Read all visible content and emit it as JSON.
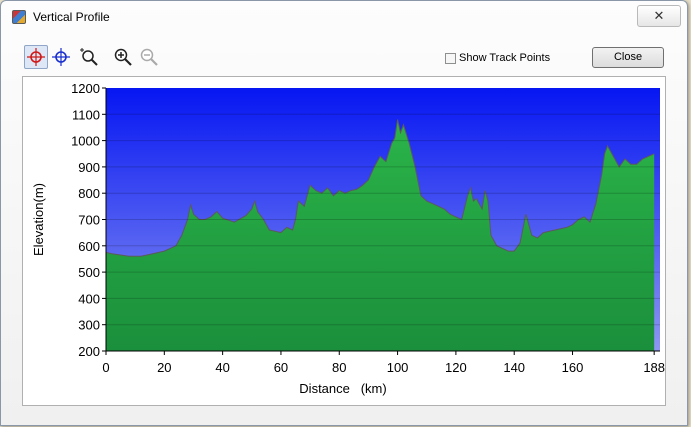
{
  "window": {
    "title": "Vertical Profile",
    "close_glyph": "✕"
  },
  "toolbar": {
    "tools": [
      {
        "icon": "crosshair-red-icon",
        "selected": true
      },
      {
        "icon": "crosshair-blue-icon",
        "selected": false
      },
      {
        "icon": "zoom-region-icon",
        "selected": false
      },
      {
        "icon": "zoom-in-icon",
        "selected": false
      },
      {
        "icon": "zoom-out-icon",
        "selected": false,
        "disabled": true
      }
    ],
    "show_track_points_label": "Show Track Points",
    "show_track_points_checked": false,
    "close_label": "Close"
  },
  "chart_data": {
    "type": "area",
    "xlabel": "Distance   (km)",
    "ylabel": "Elevation(m)",
    "x_ticks": [
      "0",
      "20",
      "40",
      "60",
      "80",
      "100",
      "120",
      "140",
      "160",
      "188"
    ],
    "x_tick_values": [
      0,
      20,
      40,
      60,
      80,
      100,
      120,
      140,
      160,
      188
    ],
    "y_ticks": [
      "200",
      "300",
      "400",
      "500",
      "600",
      "700",
      "800",
      "900",
      "1000",
      "1100",
      "1200"
    ],
    "xlim": [
      0,
      190
    ],
    "ylim": [
      200,
      1200
    ],
    "grid": "horizontal",
    "colors": {
      "sky_top": "#0616f2",
      "sky_bottom": "#8d97f1",
      "fill_top": "#2bb449",
      "fill_bottom": "#1b8f3c",
      "outline": "#5b5b5b"
    },
    "series": [
      {
        "x": [
          0,
          2,
          5,
          8,
          12,
          16,
          20,
          24,
          26,
          28,
          29,
          30,
          32,
          34,
          36,
          38,
          40,
          44,
          48,
          50,
          51,
          52,
          54,
          56,
          58,
          60,
          62,
          64,
          65,
          66,
          68,
          70,
          72,
          74,
          76,
          78,
          80,
          82,
          84,
          86,
          88,
          90,
          92,
          94,
          96,
          98,
          99,
          100,
          101,
          102,
          104,
          106,
          108,
          110,
          112,
          114,
          116,
          118,
          120,
          122,
          124,
          125,
          126,
          127,
          128,
          129,
          130,
          131,
          132,
          134,
          136,
          138,
          140,
          142,
          144,
          146,
          148,
          150,
          154,
          158,
          160,
          162,
          164,
          166,
          168,
          170,
          171,
          172,
          174,
          176,
          178,
          180,
          182,
          184,
          186,
          188
        ],
        "y": [
          575,
          570,
          565,
          560,
          560,
          570,
          580,
          600,
          640,
          700,
          755,
          720,
          700,
          700,
          710,
          730,
          705,
          690,
          715,
          740,
          770,
          730,
          700,
          660,
          655,
          650,
          670,
          660,
          700,
          770,
          750,
          830,
          810,
          800,
          820,
          790,
          810,
          800,
          810,
          815,
          830,
          850,
          900,
          940,
          920,
          990,
          1010,
          1080,
          1030,
          1060,
          990,
          900,
          790,
          770,
          760,
          750,
          740,
          720,
          710,
          700,
          790,
          820,
          770,
          780,
          760,
          740,
          810,
          770,
          640,
          600,
          590,
          580,
          580,
          610,
          720,
          640,
          630,
          650,
          660,
          670,
          680,
          700,
          710,
          690,
          760,
          870,
          950,
          980,
          940,
          900,
          930,
          910,
          910,
          930,
          940,
          950
        ]
      }
    ]
  }
}
